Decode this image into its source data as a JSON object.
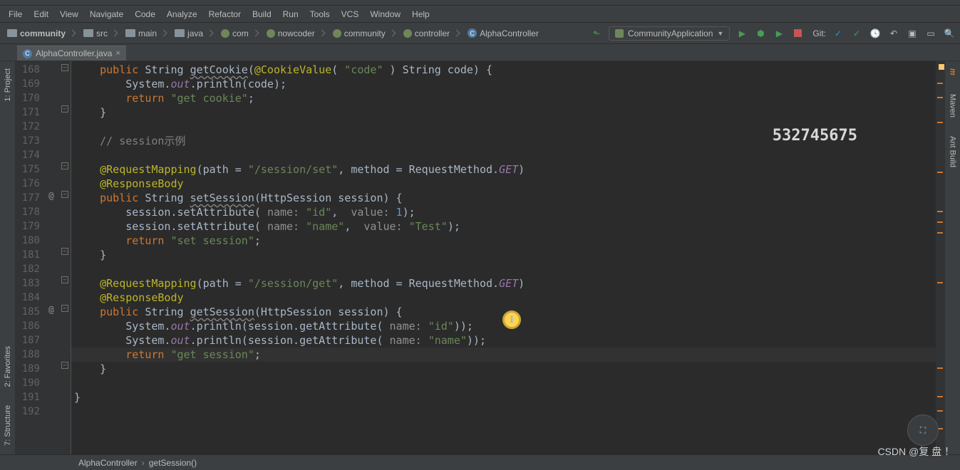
{
  "menu": [
    "File",
    "Edit",
    "View",
    "Navigate",
    "Code",
    "Analyze",
    "Refactor",
    "Build",
    "Run",
    "Tools",
    "VCS",
    "Window",
    "Help"
  ],
  "breadcrumbs": [
    {
      "label": "community",
      "icon": "folder",
      "bold": true
    },
    {
      "label": "src",
      "icon": "folder"
    },
    {
      "label": "main",
      "icon": "folder"
    },
    {
      "label": "java",
      "icon": "folder"
    },
    {
      "label": "com",
      "icon": "pkg"
    },
    {
      "label": "nowcoder",
      "icon": "pkg"
    },
    {
      "label": "community",
      "icon": "pkg"
    },
    {
      "label": "controller",
      "icon": "pkg"
    },
    {
      "label": "AlphaController",
      "icon": "class"
    }
  ],
  "runConfig": "CommunityApplication",
  "gitLabel": "Git:",
  "tab": {
    "label": "AlphaController.java"
  },
  "sideLeft": [
    "1: Project",
    "2: Favorites",
    "7: Structure"
  ],
  "sideRight": [
    "Maven",
    "Ant Build"
  ],
  "lineStart": 168,
  "lineEnd": 192,
  "overlayNumber": "532745675",
  "statusCrumbs": [
    "AlphaController",
    "getSession()"
  ],
  "watermark": "CSDN @复 盘 ！",
  "code": {
    "l168": {
      "pre": "    ",
      "kw": "public",
      "rest": " String ",
      "mth": "getCookie",
      "after": "(",
      "ann": "@CookieValue",
      "args": "( \"code\" ) String code) {"
    },
    "l169": {
      "pre": "        System.",
      "out": "out",
      "rest": ".println(code);"
    },
    "l170": {
      "pre": "        ",
      "kw": "return ",
      "str": "\"get cookie\"",
      "end": ";"
    },
    "l171": "    }",
    "l172": "",
    "l173": {
      "pre": "    ",
      "c": "// session示例"
    },
    "l174": "",
    "l175": {
      "pre": "    ",
      "ann": "@RequestMapping",
      "rest": "(path = ",
      "str": "\"/session/set\"",
      "mid": ", method = RequestMethod.",
      "get": "GET",
      "end": ")"
    },
    "l176": {
      "pre": "    ",
      "ann": "@ResponseBody"
    },
    "l177": {
      "pre": "    ",
      "kw": "public",
      "rest": " String ",
      "mth": "setSession",
      "after": "(HttpSession session) {"
    },
    "l178": {
      "pre": "        session.setAttribute( ",
      "p1": "name:",
      "v1": " \"id\"",
      "mid": ",  ",
      "p2": "value:",
      "v2": " 1",
      "end": ");"
    },
    "l179": {
      "pre": "        session.setAttribute( ",
      "p1": "name:",
      "v1": " \"name\"",
      "mid": ",  ",
      "p2": "value:",
      "v2": " \"Test\"",
      "end": ");"
    },
    "l180": {
      "pre": "        ",
      "kw": "return ",
      "str": "\"set session\"",
      "end": ";"
    },
    "l181": "    }",
    "l182": "",
    "l183": {
      "pre": "    ",
      "ann": "@RequestMapping",
      "rest": "(path = ",
      "str": "\"/session/get\"",
      "mid": ", method = RequestMethod.",
      "get": "GET",
      "end": ")"
    },
    "l184": {
      "pre": "    ",
      "ann": "@ResponseBody"
    },
    "l185": {
      "pre": "    ",
      "kw": "public",
      "rest": " String ",
      "mth": "getSession",
      "after": "(HttpSession session) {"
    },
    "l186": {
      "pre": "        System.",
      "out": "out",
      "rest": ".println(session.getAttribute( ",
      "p": "name:",
      "v": " \"id\"",
      "end": "));"
    },
    "l187": {
      "pre": "        System.",
      "out": "out",
      "rest": ".println(session.getAttribute( ",
      "p": "name:",
      "v": " \"name\"",
      "end": "));"
    },
    "l188": {
      "pre": "        ",
      "kw": "return ",
      "str": "\"get session\"",
      "end": ";"
    },
    "l189": "    }",
    "l190": "",
    "l191": "}",
    "l192": ""
  }
}
